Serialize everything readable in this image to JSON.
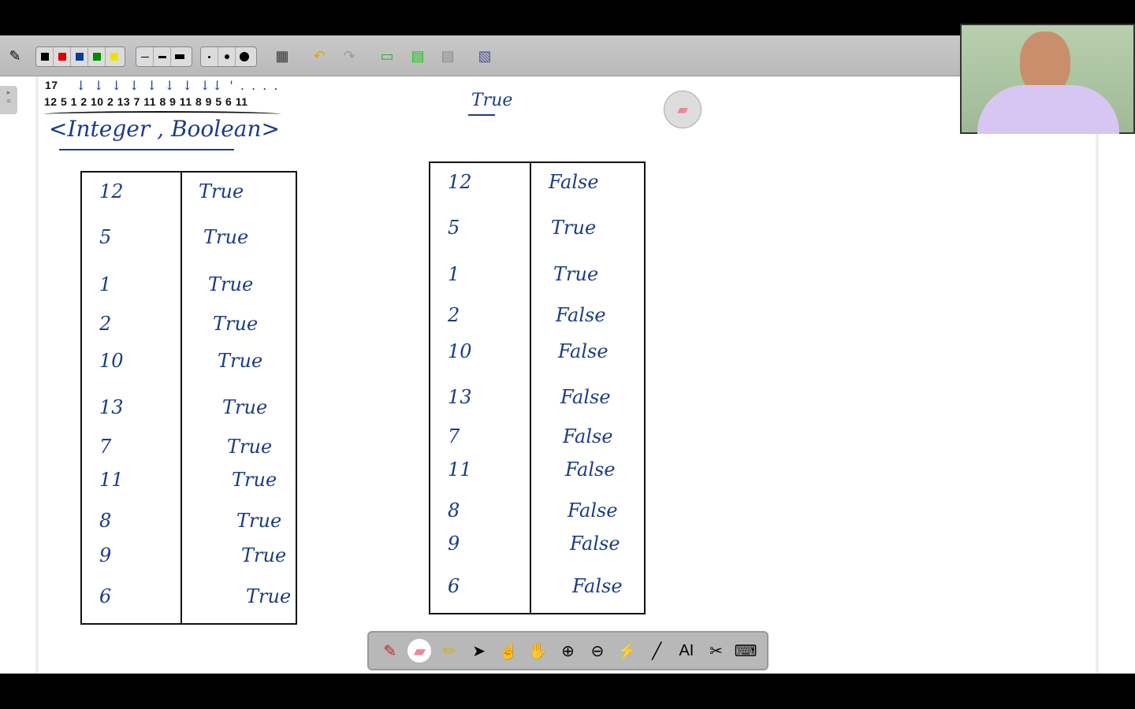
{
  "toolbar": {
    "colors": [
      "#000000",
      "#e00000",
      "#0a3a9a",
      "#008a00",
      "#f2e000"
    ],
    "line_widths": [
      "thin",
      "medium",
      "thick"
    ],
    "dot_sizes": [
      "small",
      "medium",
      "large"
    ]
  },
  "board": {
    "top_number": "17",
    "sequence": "12 5 1 2 10 2 13 7 11 8 9 11 8 9 5 6 11",
    "arrows": "↓ ↓ ↓ ↓ ↓ ↓ ↓ ↓↓ ' . . . .",
    "type_note": "<Integer , Boolean>",
    "true_note": "True",
    "left_table": [
      [
        "12",
        "True"
      ],
      [
        "5",
        "True"
      ],
      [
        "1",
        "True"
      ],
      [
        "2",
        "True"
      ],
      [
        "10",
        "True"
      ],
      [
        "13",
        "True"
      ],
      [
        "7",
        "True"
      ],
      [
        "11",
        "True"
      ],
      [
        "8",
        "True"
      ],
      [
        "9",
        "True"
      ],
      [
        "6",
        "True"
      ]
    ],
    "right_table": [
      [
        "12",
        "False"
      ],
      [
        "5",
        "True"
      ],
      [
        "1",
        "True"
      ],
      [
        "2",
        "False"
      ],
      [
        "10",
        "False"
      ],
      [
        "13",
        "False"
      ],
      [
        "7",
        "False"
      ],
      [
        "11",
        "False"
      ],
      [
        "8",
        "False"
      ],
      [
        "9",
        "False"
      ],
      [
        "6",
        "False"
      ]
    ]
  },
  "bottom_tools": [
    "pen",
    "eraser",
    "highlighter",
    "pointer",
    "click",
    "hand",
    "zoom-in",
    "zoom-out",
    "laser",
    "line",
    "text",
    "screenshot",
    "keyboard"
  ],
  "accent": "#1b3c86"
}
